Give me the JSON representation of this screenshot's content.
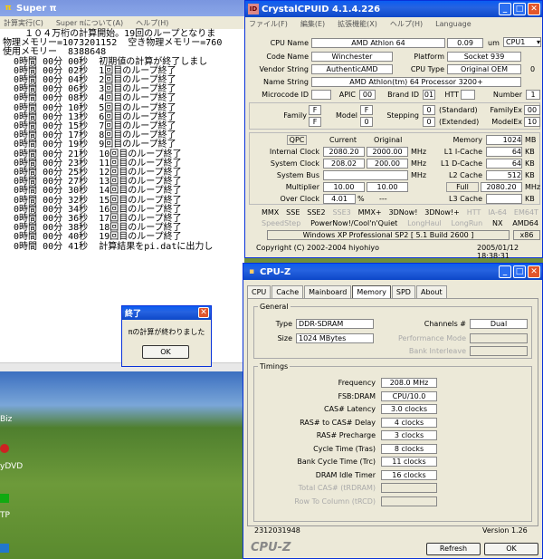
{
  "superpi": {
    "title": "Super π",
    "menu": [
      "計算実行(C)",
      "Super πについて(A)",
      "ヘルプ(H)"
    ],
    "lines": [
      "    １０４万桁の計算開始。19回のループとなりま",
      "物理メモリー=1073201152  空き物理メモリー=760",
      "使用メモリー  8388648",
      "  0時間 00分 00秒  初期値の計算が終了しまし",
      "  0時間 00分 02秒  1回目のループ終了",
      "  0時間 00分 04秒  2回目のループ終了",
      "  0時間 00分 06秒  3回目のループ終了",
      "  0時間 00分 08秒  4回目のループ終了",
      "  0時間 00分 10秒  5回目のループ終了",
      "  0時間 00分 13秒  6回目のループ終了",
      "  0時間 00分 15秒  7回目のループ終了",
      "  0時間 00分 17秒  8回目のループ終了",
      "  0時間 00分 19秒  9回目のループ終了",
      "  0時間 00分 21秒  10回目のループ終了",
      "  0時間 00分 23秒  11回目のループ終了",
      "  0時間 00分 25秒  12回目のループ終了",
      "  0時間 00分 27秒  13回目のループ終了",
      "  0時間 00分 30秒  14回目のループ終了",
      "  0時間 00分 32秒  15回目のループ終了",
      "  0時間 00分 34秒  16回目のループ終了",
      "  0時間 00分 36秒  17回目のループ終了",
      "  0時間 00分 38秒  18回目のループ終了",
      "  0時間 00分 40秒  19回目のループ終了",
      "  0時間 00分 41秒  計算結果をpi.datに出力し"
    ]
  },
  "dialog": {
    "title": "終了",
    "message": "πの計算が終わりました",
    "ok": "OK"
  },
  "desktop": {
    "icons": [
      "Biz",
      "yDVD",
      "TP"
    ]
  },
  "cpuid": {
    "title": "CrystalCPUID 4.1.4.226",
    "menu": [
      "ファイル(F)",
      "編集(E)",
      "拡張機能(X)",
      "ヘルプ(H)",
      "Language"
    ],
    "cpu_name_label": "CPU Name",
    "cpu_name": "AMD Athlon 64",
    "process": "0.09",
    "process_unit": "um",
    "cpu_select": "CPU1",
    "code_name_label": "Code Name",
    "code_name": "Winchester",
    "platform_label": "Platform",
    "platform": "Socket 939",
    "vendor_label": "Vendor String",
    "vendor": "AuthenticAMD",
    "cpu_type_label": "CPU Type",
    "cpu_type": "Original OEM",
    "cpu_type_num": "0",
    "name_string_label": "Name String",
    "name_string": "AMD Athlon(tm) 64 Processor 3200+",
    "microcode_label": "Microcode ID",
    "apic_label": "APIC",
    "apic": "00",
    "brand_label": "Brand ID",
    "brand": "01",
    "htt_label": "HTT",
    "number_label": "Number",
    "number": "1",
    "family_label": "Family",
    "family": "F",
    "family_b": "F",
    "model_label": "Model",
    "model": "F",
    "model_b": "0",
    "stepping_label": "Stepping",
    "stepping": "0",
    "stepping_b": "0",
    "standard": "(Standard)",
    "extended": "(Extended)",
    "familyex_label": "FamilyEx",
    "familyex": "00",
    "modelex_label": "ModelEx",
    "modelex": "10",
    "qpc": "QPC",
    "current": "Current",
    "original": "Original",
    "internal_clock_label": "Internal Clock",
    "internal_current": "2080.20",
    "internal_original": "2000.00",
    "mhz": "MHz",
    "system_clock_label": "System Clock",
    "system_current": "208.02",
    "system_original": "200.00",
    "system_bus_label": "System Bus",
    "multiplier_label": "Multiplier",
    "multiplier_current": "10.00",
    "multiplier_original": "10.00",
    "overclock_label": "Over Clock",
    "overclock": "4.01",
    "overclock_unit": "%",
    "overclock_dash": "---",
    "memory_label": "Memory",
    "memory": "1024",
    "mb": "MB",
    "l1i_label": "L1 I-Cache",
    "l1i": "64",
    "l1d_label": "L1 D-Cache",
    "l1d": "64",
    "l2_label": "L2 Cache",
    "l2": "512",
    "kb": "KB",
    "full": "Full",
    "full_value": "2080.20",
    "l3_label": "L3 Cache",
    "features1": [
      [
        "MMX",
        true
      ],
      [
        "SSE",
        true
      ],
      [
        "SSE2",
        true
      ],
      [
        "SSE3",
        false
      ],
      [
        "MMX+",
        true
      ],
      [
        "3DNow!",
        true
      ],
      [
        "3DNow!+",
        true
      ],
      [
        "HTT",
        false
      ],
      [
        "IA-64",
        false
      ],
      [
        "EM64T",
        false
      ]
    ],
    "features2": [
      [
        "SpeedStep",
        false
      ],
      [
        "PowerNow!/Cool'n'Quiet",
        true
      ],
      [
        "LongHaul",
        false
      ],
      [
        "LongRun",
        false
      ],
      [
        "NX",
        true
      ],
      [
        "AMD64",
        true
      ]
    ],
    "os": "Windows XP Professional SP2 [ 5.1 Build 2600 ]",
    "arch": "x86",
    "copyright": "Copyright (C) 2002-2004 hiyohiyo",
    "datetime": "2005/01/12 18:38:31"
  },
  "cpuz": {
    "title": "CPU-Z",
    "tabs": [
      "CPU",
      "Cache",
      "Mainboard",
      "Memory",
      "SPD",
      "About"
    ],
    "active_tab": "Memory",
    "general_legend": "General",
    "type_label": "Type",
    "type": "DDR-SDRAM",
    "size_label": "Size",
    "size": "1024 MBytes",
    "channels_label": "Channels #",
    "channels": "Dual",
    "perf_mode_label": "Performance Mode",
    "bank_interleave_label": "Bank Interleave",
    "timings_legend": "Timings",
    "timings": [
      [
        "Frequency",
        "208.0 MHz",
        true
      ],
      [
        "FSB:DRAM",
        "CPU/10.0",
        true
      ],
      [
        "CAS# Latency",
        "3.0 clocks",
        true
      ],
      [
        "RAS# to CAS# Delay",
        "4 clocks",
        true
      ],
      [
        "RAS# Precharge",
        "3 clocks",
        true
      ],
      [
        "Cycle Time (Tras)",
        "8 clocks",
        true
      ],
      [
        "Bank Cycle Time (Trc)",
        "11 clocks",
        true
      ],
      [
        "DRAM Idle Timer",
        "16 clocks",
        true
      ],
      [
        "Total CAS# (tRDRAM)",
        "",
        false
      ],
      [
        "Row To Column (tRCD)",
        "",
        false
      ]
    ],
    "serial": "2312031948",
    "version": "Version 1.26",
    "brand": "CPU-Z",
    "refresh": "Refresh",
    "ok": "OK"
  }
}
